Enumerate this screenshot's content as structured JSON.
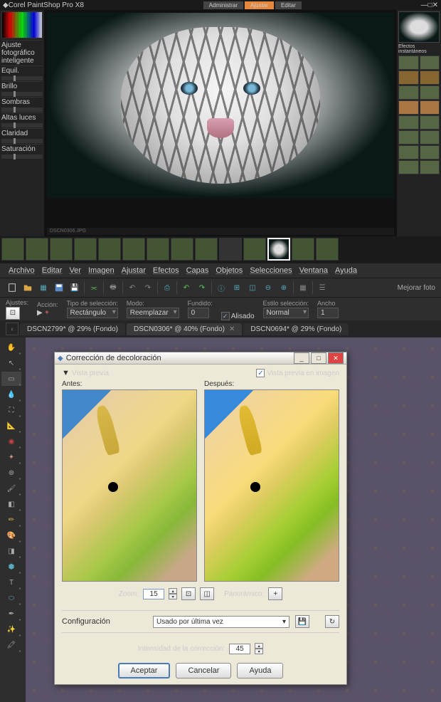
{
  "top": {
    "title": "Corel PaintShop Pro X8",
    "tabs": [
      "Administrar",
      "Ajustar",
      "Editar"
    ],
    "activeTab": 1,
    "adjustments": [
      "Ajuste fotográfico inteligente",
      "Equil.",
      "Brillo",
      "Sombras",
      "Altas luces",
      "Claridad",
      "Saturación"
    ],
    "status": "DSCN0306.JPG",
    "rightHeader": "Efectos instantáneos"
  },
  "bottom": {
    "appTitle": "Corel PaintShop Pro X8",
    "menus": [
      "Archivo",
      "Editar",
      "Ver",
      "Imagen",
      "Ajustar",
      "Efectos",
      "Capas",
      "Objetos",
      "Selecciones",
      "Ventana",
      "Ayuda"
    ],
    "improveText": "Mejorar foto",
    "options": {
      "presets": "Ajustes:",
      "action": "Acción:",
      "selType": {
        "label": "Tipo de selección:",
        "value": "Rectángulo"
      },
      "mode": {
        "label": "Modo:",
        "value": "Reemplazar"
      },
      "blend": {
        "label": "Fundido:",
        "value": "0"
      },
      "antialias": "Alisado",
      "selStyle": {
        "label": "Estilo selección:",
        "value": "Normal"
      },
      "width": {
        "label": "Ancho",
        "value": "1"
      }
    },
    "docs": [
      {
        "name": "DSCN2799* @ 29% (Fondo)",
        "active": false
      },
      {
        "name": "DSCN0306* @ 40% (Fondo)",
        "active": true
      },
      {
        "name": "DSCN0694* @ 29% (Fondo)",
        "active": false
      }
    ]
  },
  "dialog": {
    "title": "Corrección de decoloración",
    "previewToggle": "Vista previa",
    "previewInImage": "Vista previa en imagen",
    "before": "Antes:",
    "after": "Después:",
    "zoomLabel": "Zoom:",
    "zoomValue": "15",
    "panoramic": "Panorámico:",
    "configLabel": "Configuración",
    "configValue": "Usado por última vez",
    "intensityLabel": "Intensidad de la corrección:",
    "intensityValue": "45",
    "accept": "Aceptar",
    "cancel": "Cancelar",
    "help": "Ayuda"
  }
}
